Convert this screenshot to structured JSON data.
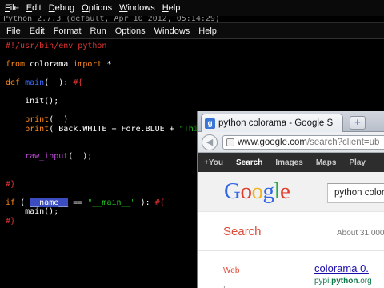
{
  "shell": {
    "menu": [
      {
        "mnemonic": "F",
        "rest": "ile"
      },
      {
        "mnemonic": "E",
        "rest": "dit"
      },
      {
        "mnemonic": "D",
        "rest": "ebug"
      },
      {
        "mnemonic": "O",
        "rest": "ptions"
      },
      {
        "mnemonic": "W",
        "rest": "indows"
      },
      {
        "mnemonic": "H",
        "rest": "elp"
      }
    ],
    "peek_text": "Python 2.7.3 (default, Apr 10 2012, 05:14:29)"
  },
  "editor": {
    "menu": [
      "File",
      "Edit",
      "Format",
      "Run",
      "Options",
      "Windows",
      "Help"
    ],
    "lines": [
      [
        {
          "t": "#!/usr/bin/env python",
          "c": "comment"
        }
      ],
      [],
      [
        {
          "t": "from",
          "c": "keyword"
        },
        {
          "t": " colorama ",
          "c": "plain"
        },
        {
          "t": "import",
          "c": "keyword"
        },
        {
          "t": " *",
          "c": "plain"
        }
      ],
      [],
      [
        {
          "t": "def",
          "c": "keyword"
        },
        {
          "t": " ",
          "c": "plain"
        },
        {
          "t": "main",
          "c": "def"
        },
        {
          "t": "(  ): ",
          "c": "plain"
        },
        {
          "t": "#{",
          "c": "comment"
        }
      ],
      [],
      [
        {
          "t": "    init();",
          "c": "plain"
        }
      ],
      [],
      [
        {
          "t": "    ",
          "c": "plain"
        },
        {
          "t": "print",
          "c": "keyword"
        },
        {
          "t": "(  )",
          "c": "plain"
        }
      ],
      [
        {
          "t": "    ",
          "c": "plain"
        },
        {
          "t": "print",
          "c": "keyword"
        },
        {
          "t": "( Back.WHITE + Fore.BLUE + ",
          "c": "plain"
        },
        {
          "t": "\"This",
          "c": "string"
        }
      ],
      [],
      [],
      [
        {
          "t": "    ",
          "c": "plain"
        },
        {
          "t": "raw_input",
          "c": "builtin"
        },
        {
          "t": "(  );",
          "c": "plain"
        }
      ],
      [],
      [],
      [
        {
          "t": "#}",
          "c": "comment"
        }
      ],
      [],
      [
        {
          "t": "if",
          "c": "keyword"
        },
        {
          "t": " ( ",
          "c": "plain"
        },
        {
          "t": "__name__",
          "c": "sel"
        },
        {
          "t": " == ",
          "c": "plain"
        },
        {
          "t": "\"__main__\"",
          "c": "string"
        },
        {
          "t": " ): ",
          "c": "plain"
        },
        {
          "t": "#{",
          "c": "comment"
        }
      ],
      [
        {
          "t": "    main();",
          "c": "plain"
        }
      ],
      [
        {
          "t": "#}",
          "c": "comment"
        }
      ]
    ]
  },
  "browser": {
    "tab_title": "python colorama - Google S",
    "tab_close": "×",
    "new_tab_label": "+",
    "back_label": "◀",
    "url_main": "www.google.com",
    "url_rest": "/search?client=ub",
    "google_bar": [
      "+You",
      "Search",
      "Images",
      "Maps",
      "Play"
    ],
    "google_bar_active": "Search",
    "logo": [
      "G",
      "o",
      "o",
      "g",
      "l",
      "e"
    ],
    "search_query": "python colora",
    "search_heading": "Search",
    "results_count": "About 31,000",
    "web_link": "Web",
    "side_bullet": "I",
    "result_title": "colorama 0.",
    "result_url_prefix": "pypi.",
    "result_url_bold": "python",
    "result_url_suffix": ".org"
  },
  "colors": {
    "comment": "#dd3333",
    "keyword": "#ff8a1a",
    "builtin": "#c04ad8",
    "string": "#22c422",
    "definition": "#3b6dff",
    "selection": "#3a4cbf",
    "google_red": "#dd4b39",
    "link_blue": "#1a0dab",
    "url_green": "#0e774a"
  },
  "icons": {
    "favicon": "google-g-icon",
    "site_identity": "globe-icon",
    "back": "back-arrow-icon",
    "new_tab": "plus-icon",
    "close_tab": "close-icon"
  }
}
